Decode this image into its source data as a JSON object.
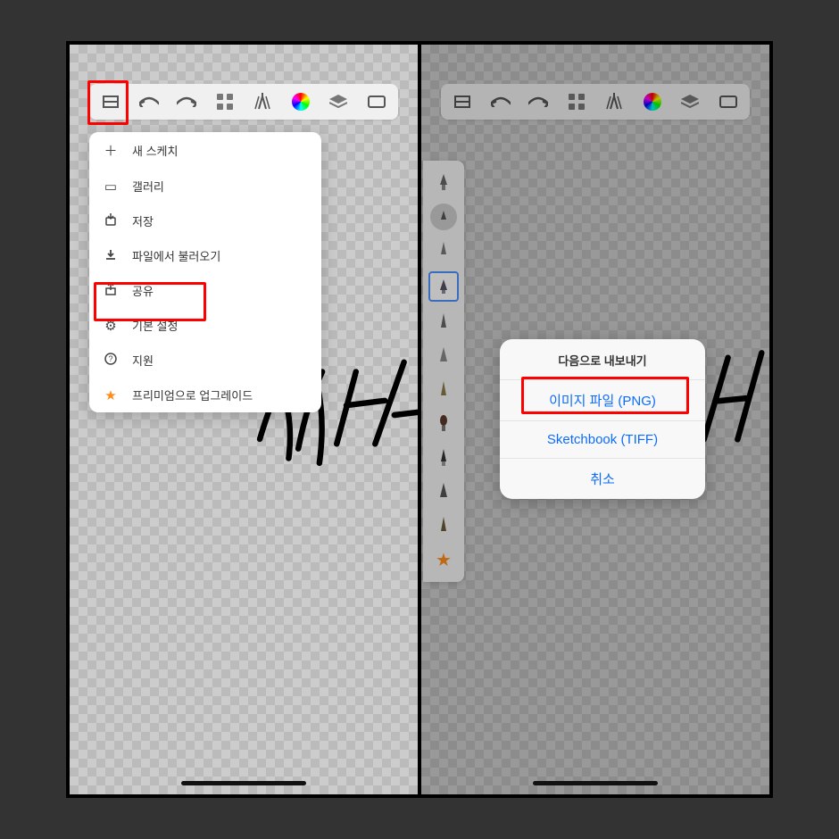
{
  "leftPane": {
    "toolbar": {
      "icons": [
        "menu",
        "undo",
        "redo",
        "grid",
        "pen",
        "color-wheel",
        "layers",
        "fullscreen"
      ]
    },
    "menu": [
      {
        "icon": "＋",
        "label": "새 스케치",
        "name": "new-sketch"
      },
      {
        "icon": "🖼",
        "label": "갤러리",
        "name": "gallery"
      },
      {
        "icon": "⬇︎",
        "label": "저장",
        "name": "save"
      },
      {
        "icon": "📥",
        "label": "파일에서 불러오기",
        "name": "import"
      },
      {
        "icon": "⇪",
        "label": "공유",
        "name": "share"
      },
      {
        "icon": "⚙",
        "label": "기본 설정",
        "name": "settings"
      },
      {
        "icon": "?",
        "label": "지원",
        "name": "support"
      },
      {
        "icon": "★",
        "label": "프리미엄으로 업그레이드",
        "name": "upgrade-premium"
      }
    ],
    "highlight_menu": true,
    "highlight_share": true
  },
  "rightPane": {
    "toolbar": {
      "icons": [
        "menu",
        "undo",
        "redo",
        "grid",
        "pen",
        "color-wheel",
        "layers",
        "fullscreen"
      ]
    },
    "brushes": {
      "count": 12,
      "selectedIndex": 3,
      "star_at_end": true
    },
    "actionSheet": {
      "title": "다음으로 내보내기",
      "options": [
        {
          "label": "이미지 파일 (PNG)",
          "name": "export-png",
          "highlighted": true
        },
        {
          "label": "Sketchbook (TIFF)",
          "name": "export-tiff"
        }
      ],
      "cancel": "취소"
    }
  }
}
